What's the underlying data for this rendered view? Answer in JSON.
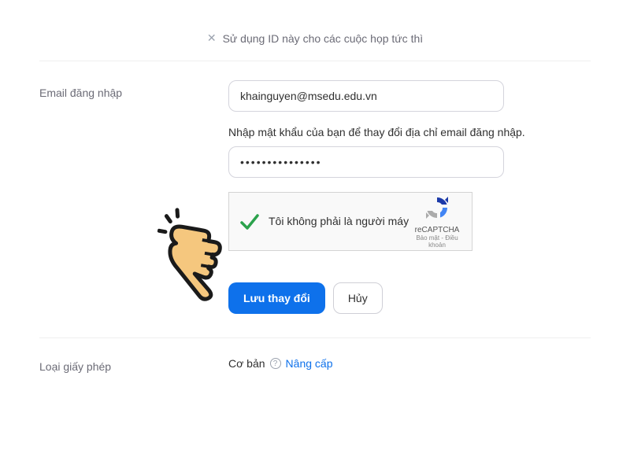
{
  "instant": {
    "label": "Sử dụng ID này cho các cuộc họp tức thì"
  },
  "login": {
    "label": "Email đăng nhập",
    "email_value": "khainguyen@msedu.edu.vn",
    "helper": "Nhập mật khẩu của bạn để thay đổi địa chỉ email đăng nhập.",
    "password_value": "•••••••••••••••"
  },
  "captcha": {
    "text": "Tôi không phải là người máy",
    "brand": "reCAPTCHA",
    "terms": "Bảo mật - Điều khoản"
  },
  "buttons": {
    "save": "Lưu thay đổi",
    "cancel": "Hủy"
  },
  "license": {
    "label": "Loại giấy phép",
    "value": "Cơ bản",
    "upgrade": "Nâng cấp"
  },
  "colors": {
    "primary": "#0E71EB"
  }
}
